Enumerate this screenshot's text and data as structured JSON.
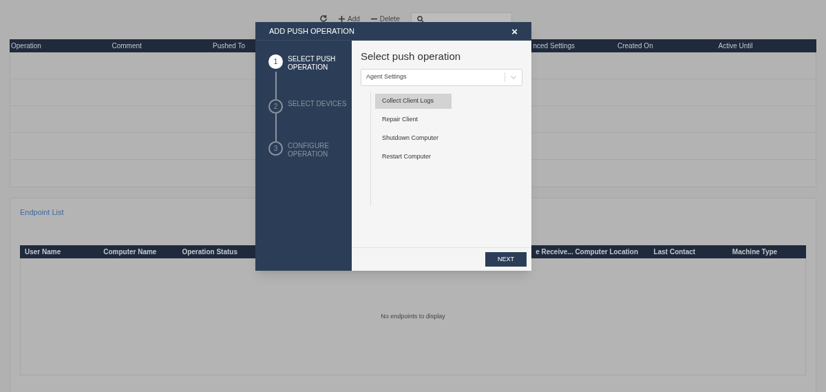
{
  "toolbar": {
    "buttons": [
      {
        "kind": "refresh"
      },
      {
        "kind": "add",
        "label": "Add"
      },
      {
        "kind": "delete",
        "label": "Delete"
      }
    ]
  },
  "operations_table": {
    "columns_left": [
      "Operation",
      "Comment",
      "Pushed To"
    ],
    "columns_right": [
      "nced Settings",
      "Created On",
      "Active Until"
    ]
  },
  "endpoint_list": {
    "title": "Endpoint List",
    "columns_left": [
      "User Name",
      "Computer Name",
      "Operation Status"
    ],
    "columns_right": [
      "e Receive...",
      "Computer Location",
      "Last Contact",
      "Machine Type"
    ],
    "empty_message": "No endpoints to display"
  },
  "dialog": {
    "title": "ADD PUSH OPERATION",
    "close": "×",
    "steps": [
      {
        "number": "1",
        "label": "SELECT PUSH OPERATION",
        "selected": true
      },
      {
        "number": "2",
        "label": "SELECT DEVICES",
        "selected": false
      },
      {
        "number": "3",
        "label": "CONFIGURE OPERATION",
        "selected": false
      }
    ],
    "heading": "Select push operation",
    "category": {
      "value": "Agent Settings"
    },
    "operations": [
      {
        "label": "Collect Client Logs",
        "selected": true
      },
      {
        "label": "Repair Client",
        "selected": false
      },
      {
        "label": "Shutdown Computer",
        "selected": false
      },
      {
        "label": "Restart Computer",
        "selected": false
      }
    ],
    "next_button": "NEXT"
  }
}
